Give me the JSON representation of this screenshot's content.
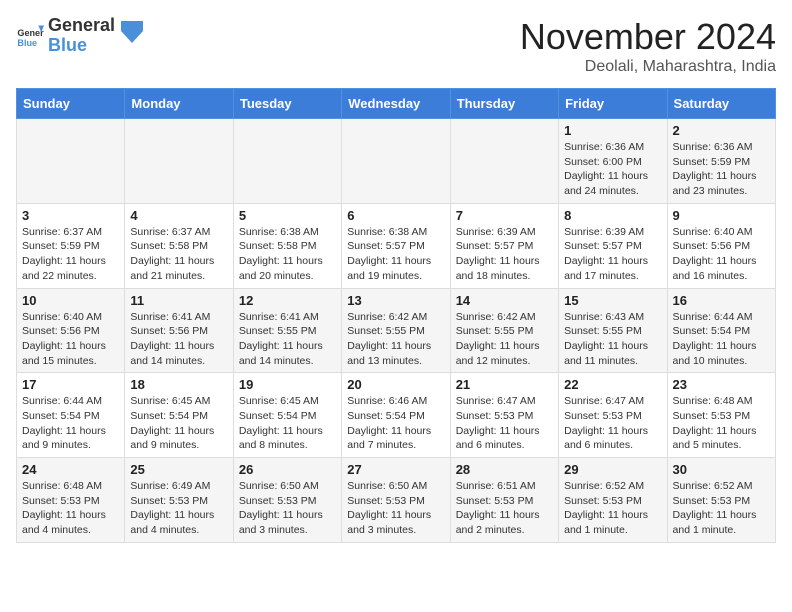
{
  "header": {
    "logo_general": "General",
    "logo_blue": "Blue",
    "month_title": "November 2024",
    "location": "Deolali, Maharashtra, India"
  },
  "weekdays": [
    "Sunday",
    "Monday",
    "Tuesday",
    "Wednesday",
    "Thursday",
    "Friday",
    "Saturday"
  ],
  "weeks": [
    [
      {
        "day": "",
        "text": ""
      },
      {
        "day": "",
        "text": ""
      },
      {
        "day": "",
        "text": ""
      },
      {
        "day": "",
        "text": ""
      },
      {
        "day": "",
        "text": ""
      },
      {
        "day": "1",
        "text": "Sunrise: 6:36 AM\nSunset: 6:00 PM\nDaylight: 11 hours and 24 minutes."
      },
      {
        "day": "2",
        "text": "Sunrise: 6:36 AM\nSunset: 5:59 PM\nDaylight: 11 hours and 23 minutes."
      }
    ],
    [
      {
        "day": "3",
        "text": "Sunrise: 6:37 AM\nSunset: 5:59 PM\nDaylight: 11 hours and 22 minutes."
      },
      {
        "day": "4",
        "text": "Sunrise: 6:37 AM\nSunset: 5:58 PM\nDaylight: 11 hours and 21 minutes."
      },
      {
        "day": "5",
        "text": "Sunrise: 6:38 AM\nSunset: 5:58 PM\nDaylight: 11 hours and 20 minutes."
      },
      {
        "day": "6",
        "text": "Sunrise: 6:38 AM\nSunset: 5:57 PM\nDaylight: 11 hours and 19 minutes."
      },
      {
        "day": "7",
        "text": "Sunrise: 6:39 AM\nSunset: 5:57 PM\nDaylight: 11 hours and 18 minutes."
      },
      {
        "day": "8",
        "text": "Sunrise: 6:39 AM\nSunset: 5:57 PM\nDaylight: 11 hours and 17 minutes."
      },
      {
        "day": "9",
        "text": "Sunrise: 6:40 AM\nSunset: 5:56 PM\nDaylight: 11 hours and 16 minutes."
      }
    ],
    [
      {
        "day": "10",
        "text": "Sunrise: 6:40 AM\nSunset: 5:56 PM\nDaylight: 11 hours and 15 minutes."
      },
      {
        "day": "11",
        "text": "Sunrise: 6:41 AM\nSunset: 5:56 PM\nDaylight: 11 hours and 14 minutes."
      },
      {
        "day": "12",
        "text": "Sunrise: 6:41 AM\nSunset: 5:55 PM\nDaylight: 11 hours and 14 minutes."
      },
      {
        "day": "13",
        "text": "Sunrise: 6:42 AM\nSunset: 5:55 PM\nDaylight: 11 hours and 13 minutes."
      },
      {
        "day": "14",
        "text": "Sunrise: 6:42 AM\nSunset: 5:55 PM\nDaylight: 11 hours and 12 minutes."
      },
      {
        "day": "15",
        "text": "Sunrise: 6:43 AM\nSunset: 5:55 PM\nDaylight: 11 hours and 11 minutes."
      },
      {
        "day": "16",
        "text": "Sunrise: 6:44 AM\nSunset: 5:54 PM\nDaylight: 11 hours and 10 minutes."
      }
    ],
    [
      {
        "day": "17",
        "text": "Sunrise: 6:44 AM\nSunset: 5:54 PM\nDaylight: 11 hours and 9 minutes."
      },
      {
        "day": "18",
        "text": "Sunrise: 6:45 AM\nSunset: 5:54 PM\nDaylight: 11 hours and 9 minutes."
      },
      {
        "day": "19",
        "text": "Sunrise: 6:45 AM\nSunset: 5:54 PM\nDaylight: 11 hours and 8 minutes."
      },
      {
        "day": "20",
        "text": "Sunrise: 6:46 AM\nSunset: 5:54 PM\nDaylight: 11 hours and 7 minutes."
      },
      {
        "day": "21",
        "text": "Sunrise: 6:47 AM\nSunset: 5:53 PM\nDaylight: 11 hours and 6 minutes."
      },
      {
        "day": "22",
        "text": "Sunrise: 6:47 AM\nSunset: 5:53 PM\nDaylight: 11 hours and 6 minutes."
      },
      {
        "day": "23",
        "text": "Sunrise: 6:48 AM\nSunset: 5:53 PM\nDaylight: 11 hours and 5 minutes."
      }
    ],
    [
      {
        "day": "24",
        "text": "Sunrise: 6:48 AM\nSunset: 5:53 PM\nDaylight: 11 hours and 4 minutes."
      },
      {
        "day": "25",
        "text": "Sunrise: 6:49 AM\nSunset: 5:53 PM\nDaylight: 11 hours and 4 minutes."
      },
      {
        "day": "26",
        "text": "Sunrise: 6:50 AM\nSunset: 5:53 PM\nDaylight: 11 hours and 3 minutes."
      },
      {
        "day": "27",
        "text": "Sunrise: 6:50 AM\nSunset: 5:53 PM\nDaylight: 11 hours and 3 minutes."
      },
      {
        "day": "28",
        "text": "Sunrise: 6:51 AM\nSunset: 5:53 PM\nDaylight: 11 hours and 2 minutes."
      },
      {
        "day": "29",
        "text": "Sunrise: 6:52 AM\nSunset: 5:53 PM\nDaylight: 11 hours and 1 minute."
      },
      {
        "day": "30",
        "text": "Sunrise: 6:52 AM\nSunset: 5:53 PM\nDaylight: 11 hours and 1 minute."
      }
    ]
  ]
}
